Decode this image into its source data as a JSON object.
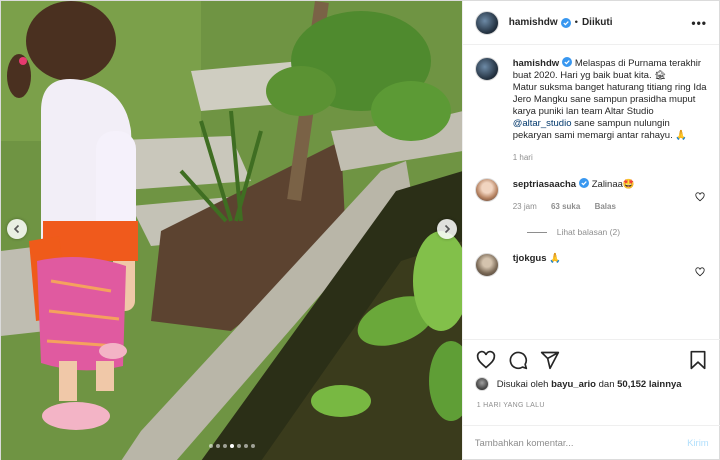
{
  "header": {
    "username": "hamishdw",
    "separator": "•",
    "follow_state": "Diikuti"
  },
  "caption": {
    "username": "hamishdw",
    "text_line1": "Melaspas di Purnama terakhir buat 2020. Hari yg baik buat kita. 🏚",
    "text_line2_a": "Matur suksma banget haturang titiang ring Ida Jero Mangku sane sampun prasidha muput karya puniki lan team Altar Studio ",
    "mention": "@altar_studio",
    "text_line2_b": " sane sampun nulungin pekaryan sami memargi antar rahayu. 🙏",
    "time": "1 hari"
  },
  "comments": [
    {
      "username": "septriasaacha",
      "text": "Zalinaa🤩",
      "time": "23 jam",
      "likes": "63 suka",
      "reply": "Balas"
    },
    {
      "username": "tjokgus",
      "text": "🙏"
    }
  ],
  "view_replies": "Lihat balasan (2)",
  "likes": {
    "prefix": "Disukai oleh",
    "user": "bayu_ario",
    "conj": "dan",
    "count": "50,152 lainnya"
  },
  "date": "1 HARI YANG LALU",
  "add_comment": {
    "placeholder": "Tambahkan komentar...",
    "post_label": "Kirim"
  },
  "icons": {
    "like": "heart-icon",
    "comment": "comment-icon",
    "share": "share-icon",
    "save": "bookmark-icon",
    "more": "more-options-icon"
  },
  "carousel": {
    "slides": 7,
    "active": 3
  },
  "colors": {
    "verified": "#3897f0",
    "link": "#00376b",
    "muted": "#8e8e8e",
    "post_disabled": "#b2dffc"
  }
}
